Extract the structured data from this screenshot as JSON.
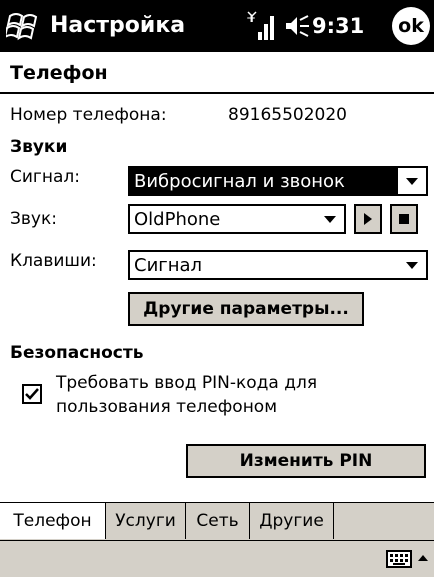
{
  "titlebar": {
    "title": "Настройка",
    "time": "9:31",
    "ok_label": "ok"
  },
  "page": {
    "title": "Телефон"
  },
  "phone": {
    "number_label": "Номер телефона:",
    "number_value": "89165502020"
  },
  "sounds": {
    "heading": "Звуки",
    "signal_label": "Сигнал:",
    "signal_value": "Вибросигнал и звонок",
    "sound_label": "Звук:",
    "sound_value": "OldPhone",
    "keys_label": "Клавиши:",
    "keys_value": "Сигнал",
    "more_button": "Другие параметры..."
  },
  "security": {
    "heading": "Безопасность",
    "pin_line1": "Требовать ввод PIN-кода для",
    "pin_line2": "пользования телефоном",
    "pin_checked": true,
    "change_pin_button": "Изменить PIN"
  },
  "tabs": [
    "Телефон",
    "Услуги",
    "Сеть",
    "Другие"
  ],
  "colors": {
    "titlebar_bg": "#000000",
    "button_face": "#d4d0c8"
  },
  "icons": [
    "windows-start-icon",
    "signal-icon",
    "volume-icon",
    "keyboard-icon",
    "up-arrow-icon"
  ]
}
